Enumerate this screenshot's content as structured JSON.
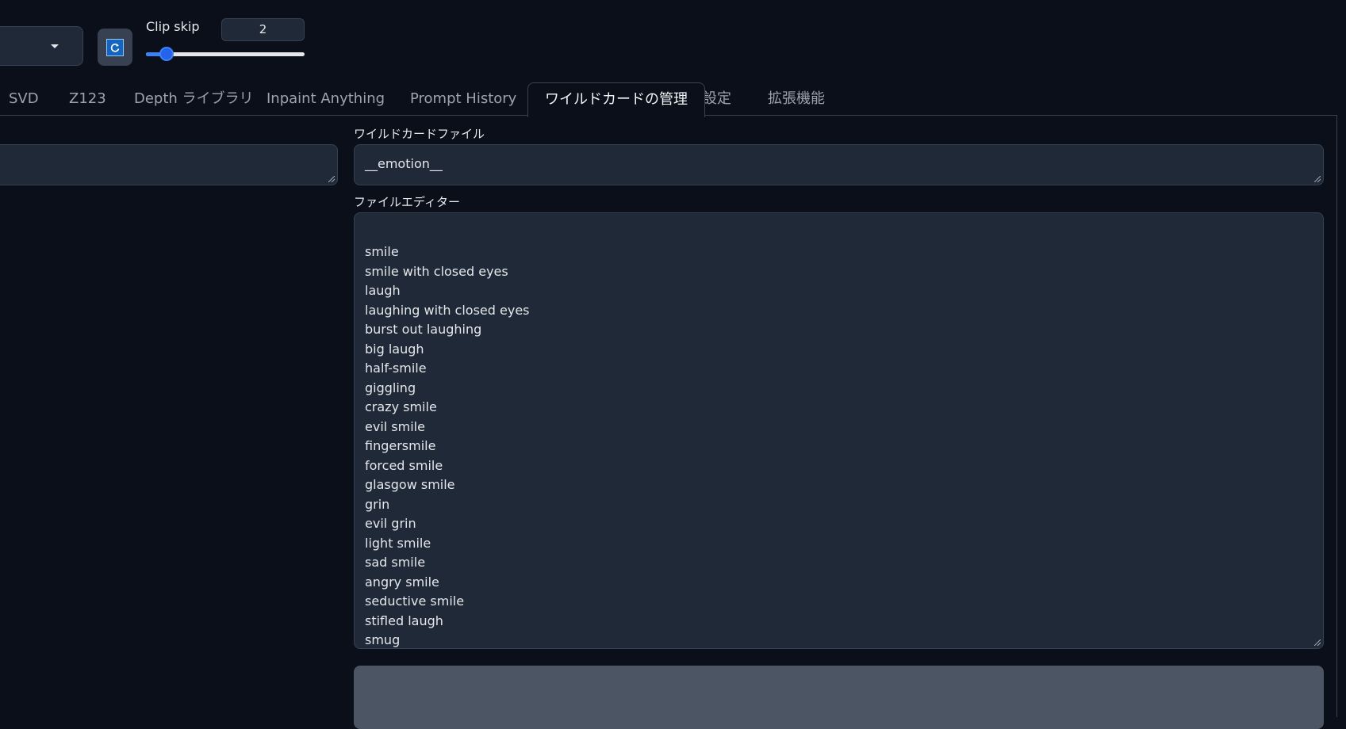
{
  "toolbar": {
    "refresh_icon": "refresh-icon",
    "clip_skip": {
      "label": "Clip skip",
      "value": "2",
      "min": 1,
      "max": 12
    }
  },
  "tabs": [
    {
      "label": "SVD",
      "active": false
    },
    {
      "label": "Z123",
      "active": false
    },
    {
      "label": "Depth ライブラリ",
      "active": false
    },
    {
      "label": "Inpaint Anything",
      "active": false
    },
    {
      "label": "Prompt History",
      "active": false
    },
    {
      "label": "ワイルドカードの管理",
      "active": true
    },
    {
      "label": "設定",
      "active": false
    },
    {
      "label": "拡張機能",
      "active": false
    }
  ],
  "wildcard_file": {
    "label": "ワイルドカードファイル",
    "value": "__emotion__"
  },
  "file_editor": {
    "label": "ファイルエディター",
    "lines": [
      "smile",
      "smile with closed eyes",
      "laugh",
      "laughing with closed eyes",
      "burst out laughing",
      "big laugh",
      "half-smile",
      "giggling",
      "crazy smile",
      "evil smile",
      "fingersmile",
      "forced smile",
      "glasgow smile",
      "grin",
      "evil grin",
      "light smile",
      "sad smile",
      "angry smile",
      "seductive smile",
      "stifled laugh",
      "smug"
    ]
  },
  "colors": {
    "background": "#0b0f19",
    "panel": "#1f2937",
    "border": "#374151",
    "accent": "#3b82f6"
  }
}
